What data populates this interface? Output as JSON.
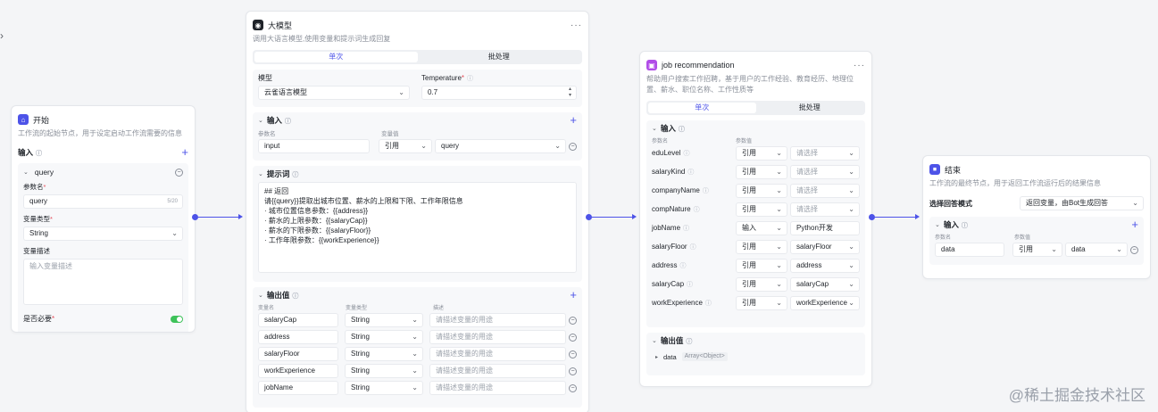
{
  "colors": {
    "accent": "#4d53e8",
    "toggle_on": "#3ec25a"
  },
  "start_node": {
    "icon": "home-icon",
    "title": "开始",
    "desc": "工作流的起始节点，用于设定启动工作流需要的信息",
    "input_label": "输入",
    "param_name": "query",
    "param_name_label": "参数名",
    "param_name_value": "query",
    "param_name_count": "5/20",
    "type_label": "变量类型",
    "type_value": "String",
    "desc_label": "变量描述",
    "desc_placeholder": "输入变量描述",
    "required_label": "是否必要"
  },
  "llm_node": {
    "icon": "llm-icon",
    "title": "大模型",
    "desc": "调用大语言模型,使用变量和提示词生成回复",
    "tabs": [
      "单次",
      "批处理"
    ],
    "model_label": "模型",
    "model_value": "云雀语言模型",
    "temp_label": "Temperature",
    "temp_value": "0.7",
    "input_title": "输入",
    "col_param": "参数名",
    "col_var": "变量值",
    "input_row": {
      "name": "input",
      "mode": "引用",
      "value": "query"
    },
    "prompt_title": "提示词",
    "prompt_lines": [
      "## 返回",
      "请{{query}}提取出城市位置、薪水的上限和下限、工作年限信息",
      "· 城市位置信息参数：{{address}}",
      "· 薪水的上限参数：{{salaryCap}}",
      "· 薪水的下限参数：{{salaryFloor}}",
      "· 工作年限参数：{{workExperience}}"
    ],
    "output_title": "输出值",
    "out_col_name": "变量名",
    "out_col_type": "变量类型",
    "out_col_desc": "描述",
    "desc_placeholder": "请描述变量的用途",
    "outputs": [
      {
        "name": "salaryCap",
        "type": "String"
      },
      {
        "name": "address",
        "type": "String"
      },
      {
        "name": "salaryFloor",
        "type": "String"
      },
      {
        "name": "workExperience",
        "type": "String"
      },
      {
        "name": "jobName",
        "type": "String"
      }
    ]
  },
  "job_node": {
    "icon": "plugin-icon",
    "title": "job recommendation",
    "desc": "帮助用户搜索工作招聘，基于用户的工作经验、教育经历、地理位置、薪水、职位名称、工作性质等",
    "tabs": [
      "单次",
      "批处理"
    ],
    "input_title": "输入",
    "col_param": "参数名",
    "col_var": "参数值",
    "select_placeholder": "请选择",
    "inputs": [
      {
        "name": "eduLevel",
        "mode": "引用",
        "value": ""
      },
      {
        "name": "salaryKind",
        "mode": "引用",
        "value": ""
      },
      {
        "name": "companyName",
        "mode": "引用",
        "value": ""
      },
      {
        "name": "compNature",
        "mode": "引用",
        "value": ""
      },
      {
        "name": "jobName",
        "mode": "输入",
        "value": "Python开发"
      },
      {
        "name": "salaryFloor",
        "mode": "引用",
        "value": "salaryFloor"
      },
      {
        "name": "address",
        "mode": "引用",
        "value": "address"
      },
      {
        "name": "salaryCap",
        "mode": "引用",
        "value": "salaryCap"
      },
      {
        "name": "workExperience",
        "mode": "引用",
        "value": "workExperience"
      }
    ],
    "output_title": "输出值",
    "output_name": "data",
    "output_type": "Array<Object>"
  },
  "end_node": {
    "icon": "end-icon",
    "title": "结束",
    "desc": "工作流的最终节点，用于返回工作流运行后的结果信息",
    "mode_label": "选择回答模式",
    "mode_value": "返回变量，由Bot生成回答",
    "input_title": "输入",
    "col_param": "参数名",
    "col_var": "参数值",
    "row": {
      "name": "data",
      "mode": "引用",
      "value": "data"
    }
  },
  "watermark": "@稀土掘金技术社区"
}
